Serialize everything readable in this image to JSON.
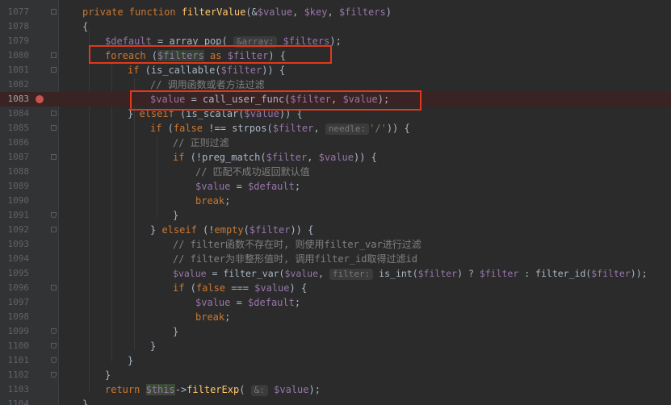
{
  "lines": [
    {
      "n": "1077"
    },
    {
      "n": "1078"
    },
    {
      "n": "1079"
    },
    {
      "n": "1080"
    },
    {
      "n": "1081"
    },
    {
      "n": "1082"
    },
    {
      "n": "1083"
    },
    {
      "n": "1084"
    },
    {
      "n": "1085"
    },
    {
      "n": "1086"
    },
    {
      "n": "1087"
    },
    {
      "n": "1088"
    },
    {
      "n": "1089"
    },
    {
      "n": "1090"
    },
    {
      "n": "1091"
    },
    {
      "n": "1092"
    },
    {
      "n": "1093"
    },
    {
      "n": "1094"
    },
    {
      "n": "1095"
    },
    {
      "n": "1096"
    },
    {
      "n": "1097"
    },
    {
      "n": "1098"
    },
    {
      "n": "1099"
    },
    {
      "n": "1100"
    },
    {
      "n": "1101"
    },
    {
      "n": "1102"
    },
    {
      "n": "1103"
    },
    {
      "n": "1104"
    }
  ],
  "code": {
    "l1077": {
      "kw1": "private function",
      "fn": "filterValue",
      "p1": "(&",
      "v1": "$value",
      "c1": ", ",
      "v2": "$key",
      "c2": ", ",
      "v3": "$filters",
      "p2": ")"
    },
    "l1078": {
      "t": "{"
    },
    "l1079": {
      "v1": "$default",
      "eq": " = array_pop(",
      "hint": "&array:",
      "v2": "$filters",
      "end": ");"
    },
    "l1080": {
      "kw": "foreach",
      "p1": " (",
      "v1": "$filters",
      "kw2": " as ",
      "v2": "$filter",
      "end": ") {"
    },
    "l1081": {
      "kw": "if",
      "p1": " (is_callable(",
      "v1": "$filter",
      "end": ")) {"
    },
    "l1082": {
      "cm": "// 调用函数或者方法过滤"
    },
    "l1083": {
      "v1": "$value",
      "eq": " = call_user_func(",
      "v2": "$filter",
      "c": ", ",
      "v3": "$value",
      "end": ");"
    },
    "l1084": {
      "p1": "} ",
      "kw": "elseif",
      "p2": " (is_scalar(",
      "v1": "$value",
      "end": ")) {"
    },
    "l1085": {
      "kw": "if",
      "p1": " (",
      "kw2": "false",
      "p2": " !== strpos(",
      "v1": "$filter",
      "c": ", ",
      "hint": "needle:",
      "str": "'/'",
      "end": ")) {"
    },
    "l1086": {
      "cm": "// 正则过滤"
    },
    "l1087": {
      "kw": "if",
      "p1": " (!preg_match(",
      "v1": "$filter",
      "c": ", ",
      "v2": "$value",
      "end": ")) {"
    },
    "l1088": {
      "cm": "// 匹配不成功返回默认值"
    },
    "l1089": {
      "v1": "$value",
      "eq": " = ",
      "v2": "$default",
      "end": ";"
    },
    "l1090": {
      "kw": "break",
      "end": ";"
    },
    "l1091": {
      "t": "}"
    },
    "l1092": {
      "p1": "} ",
      "kw": "elseif",
      "p2": " (!",
      "kw2": "empty",
      "p3": "(",
      "v1": "$filter",
      "end": ")) {"
    },
    "l1093": {
      "cm": "// filter函数不存在时, 则使用filter_var进行过滤"
    },
    "l1094": {
      "cm": "// filter为非整形值时, 调用filter_id取得过滤id"
    },
    "l1095": {
      "v1": "$value",
      "eq": " = filter_var(",
      "v2": "$value",
      "c": ", ",
      "hint": "filter:",
      "p2": " is_int(",
      "v3": "$filter",
      "p3": ") ? ",
      "v4": "$filter",
      "p4": " : filter_id(",
      "v5": "$filter",
      "end": "));"
    },
    "l1096": {
      "kw": "if",
      "p1": " (",
      "kw2": "false",
      "p2": " === ",
      "v1": "$value",
      "end": ") {"
    },
    "l1097": {
      "v1": "$value",
      "eq": " = ",
      "v2": "$default",
      "end": ";"
    },
    "l1098": {
      "kw": "break",
      "end": ";"
    },
    "l1099": {
      "t": "}"
    },
    "l1100": {
      "t": "}"
    },
    "l1101": {
      "t": "}"
    },
    "l1102": {
      "t": "}"
    },
    "l1103": {
      "kw": "return",
      "sp": " ",
      "v1": "$this",
      "arrow": "->",
      "fn": "filterExp",
      "p1": "(",
      "hint": "&:",
      "v2": "$value",
      "end": ");"
    },
    "l1104": {
      "t": "}"
    }
  },
  "colors": {
    "background": "#2b2b2b",
    "keyword": "#cc7832",
    "variable": "#9876aa",
    "function": "#ffc66d",
    "string": "#6a8759",
    "comment": "#808080",
    "annotation_box": "#e0391b",
    "breakpoint": "#c75450"
  }
}
